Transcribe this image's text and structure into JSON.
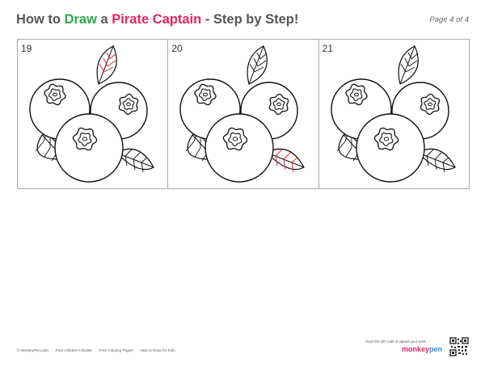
{
  "header": {
    "title_parts": [
      "How to ",
      "Draw",
      " a ",
      "Pirate Captain",
      " - Step by Step!"
    ],
    "page_label": "Page 4 of 4"
  },
  "steps": [
    {
      "number": "19",
      "highlight": "top-leaf"
    },
    {
      "number": "20",
      "highlight": "right-leaf"
    },
    {
      "number": "21",
      "highlight": "none"
    }
  ],
  "footer": {
    "links": [
      "© MonkeyPen.com",
      "· Free Children's Books",
      "· Free Coloring Pages",
      "· How to Draw for Kids"
    ],
    "scan_text": "Scan the QR code & upload your work",
    "logo_monkey": "monkey",
    "logo_pen": "pen"
  },
  "colors": {
    "green": "#2aa84a",
    "pink": "#e0245e",
    "highlight": "#e02020"
  }
}
